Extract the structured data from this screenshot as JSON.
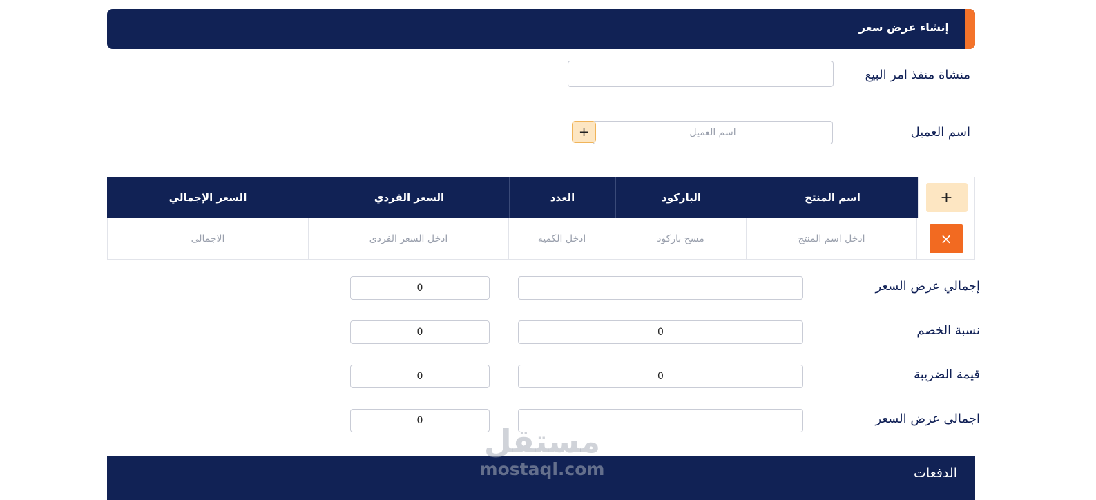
{
  "header": {
    "title": "إنشاء عرض سعر"
  },
  "form": {
    "seller_label": "منشاة منفذ امر البيع",
    "seller_value": "",
    "customer_label": "اسم العميل",
    "customer_placeholder": "اسم العميل",
    "add_customer_label": "+"
  },
  "table": {
    "add_row_label": "+",
    "headers": [
      "اسم المنتج",
      "الباركود",
      "العدد",
      "السعر الفردي",
      "السعر الإجمالي"
    ],
    "row": {
      "delete_label": "×",
      "product_placeholder": "ادخل اسم المنتج",
      "barcode_placeholder": "مسح باركود",
      "qty_placeholder": "ادخل الكميه",
      "unit_price_placeholder": "ادخل السعر الفردى",
      "total_placeholder": "الاجمالى"
    }
  },
  "summary": {
    "rows": [
      {
        "label": "إجمالي عرض السعر",
        "wide_value": "",
        "small_value": "0"
      },
      {
        "label": "نسبة الخصم",
        "wide_value": "0",
        "small_value": "0"
      },
      {
        "label": "قيمة الضريبة",
        "wide_value": "0",
        "small_value": "0"
      },
      {
        "label": "اجمالى عرض السعر",
        "wide_value": "",
        "small_value": "0"
      }
    ]
  },
  "payments": {
    "title": "الدفعات"
  },
  "watermark": {
    "arabic": "مستقل",
    "latin": "mostaql.com"
  },
  "colors": {
    "navy": "#112255",
    "orange": "#f26a21",
    "light_orange": "#fde6c2"
  }
}
